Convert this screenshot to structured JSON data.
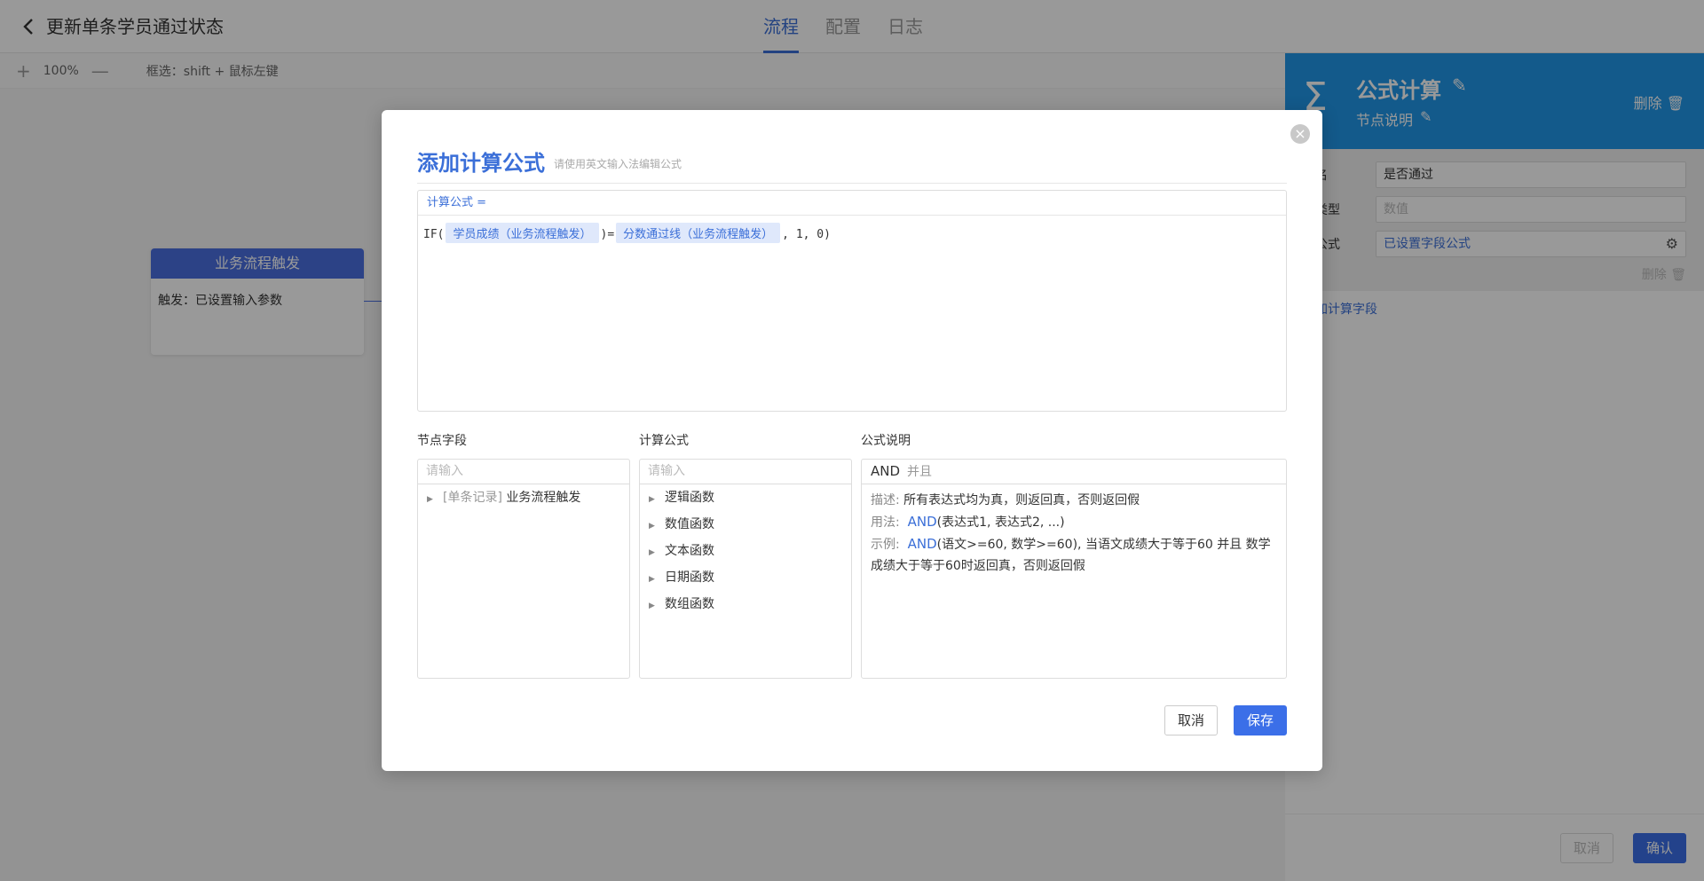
{
  "header": {
    "back_icon": "chevron-left-icon",
    "title": "更新单条学员通过状态",
    "tabs": [
      {
        "label": "流程",
        "active": true
      },
      {
        "label": "配置",
        "active": false
      },
      {
        "label": "日志",
        "active": false
      }
    ]
  },
  "toolbar": {
    "zoom_in": "+",
    "zoom_level": "100%",
    "zoom_out": "—",
    "hint": "框选：shift + 鼠标左键"
  },
  "canvas": {
    "node": {
      "title": "业务流程触发",
      "body": "触发：已设置输入参数"
    }
  },
  "panel": {
    "icon": "sigma-icon",
    "title": "公式计算",
    "subtitle": "节点说明",
    "delete_label": "删除",
    "fields": {
      "name_label": "段名",
      "name_value": "是否通过",
      "type_label": "段类型",
      "type_placeholder": "数值",
      "formula_label": "段公式",
      "formula_value": "已设置字段公式",
      "delete_label": "删除"
    },
    "add_field": "添加计算字段",
    "cancel": "取消",
    "confirm": "确认"
  },
  "modal": {
    "title": "添加计算公式",
    "hint": "请使用英文输入法编辑公式",
    "editor_label": "计算公式 =",
    "formula": {
      "prefix": "IF(",
      "field1": "学员成绩（业务流程触发）",
      "op": ")=",
      "field2": "分数通过线（业务流程触发）",
      "suffix": ", 1, 0)"
    },
    "columns": {
      "fields_label": "节点字段",
      "fields_placeholder": "请输入",
      "fields_tree": [
        {
          "tag": "[单条记录]",
          "label": "业务流程触发"
        }
      ],
      "formulas_label": "计算公式",
      "formulas_placeholder": "请输入",
      "formulas_tree": [
        "逻辑函数",
        "数值函数",
        "文本函数",
        "日期函数",
        "数组函数"
      ],
      "doc_label": "公式说明",
      "doc": {
        "fn": "AND",
        "fn_sub": "并且",
        "desc_key": "描述:",
        "desc": "所有表达式均为真，则返回真，否则返回假",
        "usage_key": "用法:",
        "usage_fn": "AND",
        "usage": "(表达式1, 表达式2, ...)",
        "example_key": "示例:",
        "example_fn": "AND",
        "example": "(语文>=60, 数学>=60), 当语文成绩大于等于60 并且 数学成绩大于等于60时返回真，否则返回假"
      }
    },
    "cancel": "取消",
    "save": "保存"
  },
  "colors": {
    "accent": "#3b6fd8",
    "panel_header": "#2196e8",
    "node_header": "#4a6fe0"
  }
}
